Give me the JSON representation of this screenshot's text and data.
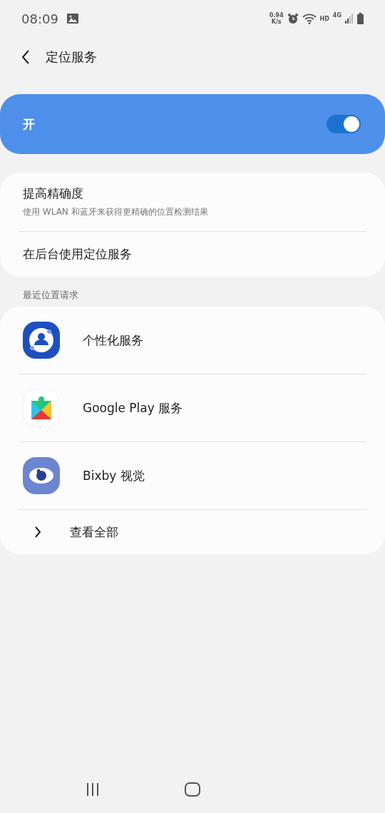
{
  "status_bar": {
    "time": "08:09",
    "speed_value": "0.94",
    "speed_unit": "K/s",
    "hd": "HD",
    "network": "4G"
  },
  "header": {
    "title": "定位服务"
  },
  "master_switch": {
    "label": "开",
    "on": true
  },
  "settings": [
    {
      "title": "提高精确度",
      "subtitle": "使用 WLAN 和蓝牙来获得更精确的位置检测结果"
    },
    {
      "title": "在后台使用定位服务"
    }
  ],
  "recent_requests": {
    "heading": "最近位置请求",
    "apps": [
      {
        "name": "个性化服务",
        "kind": "personal"
      },
      {
        "name": "Google Play 服务",
        "kind": "play"
      },
      {
        "name": "Bixby 视觉",
        "kind": "bixby"
      }
    ],
    "see_all": "查看全部"
  }
}
